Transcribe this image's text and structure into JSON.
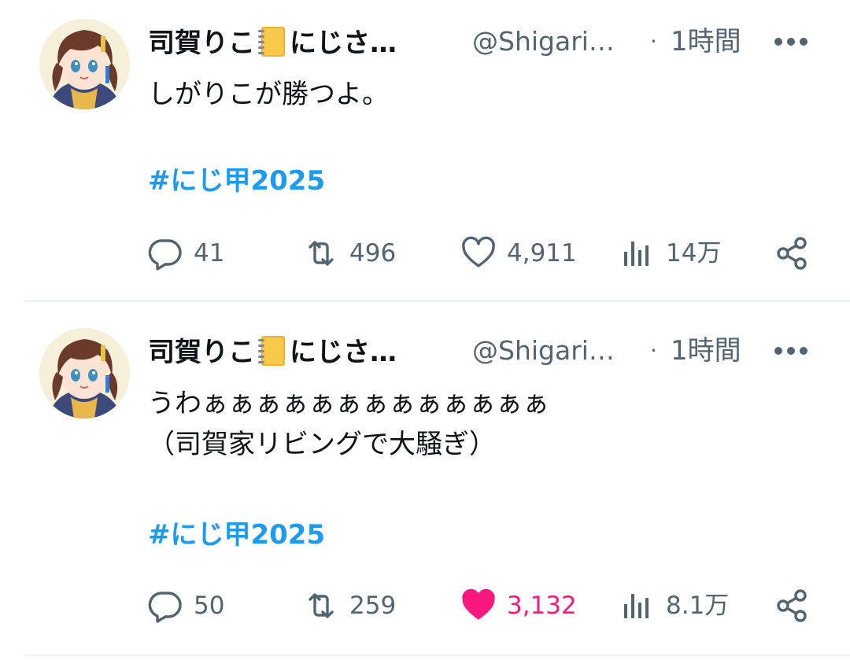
{
  "colors": {
    "text": "#0f1419",
    "secondary": "#536471",
    "hashtag": "#1d9bf0",
    "like_active": "#f91880",
    "divider": "#eff3f4"
  },
  "tweets": [
    {
      "name_start": "司賀りこ",
      "name_badge_icon": "notebook-emoji",
      "name_end": "にじさ…",
      "handle": "@Shigari…",
      "separator": "·",
      "time": "1時間",
      "text": "しがりこが勝つよ。",
      "hashtag": "#にじ甲2025",
      "replies": "41",
      "retweets": "496",
      "likes": "4,911",
      "liked": false,
      "views": "14万"
    },
    {
      "name_start": "司賀りこ",
      "name_badge_icon": "notebook-emoji",
      "name_end": "にじさ…",
      "handle": "@Shigari…",
      "separator": "·",
      "time": "1時間",
      "text": "うわぁぁぁぁぁぁぁぁぁぁぁぁぁ\n（司賀家リビングで大騒ぎ）",
      "hashtag": "#にじ甲2025",
      "replies": "50",
      "retweets": "259",
      "likes": "3,132",
      "liked": true,
      "views": "8.1万"
    }
  ]
}
